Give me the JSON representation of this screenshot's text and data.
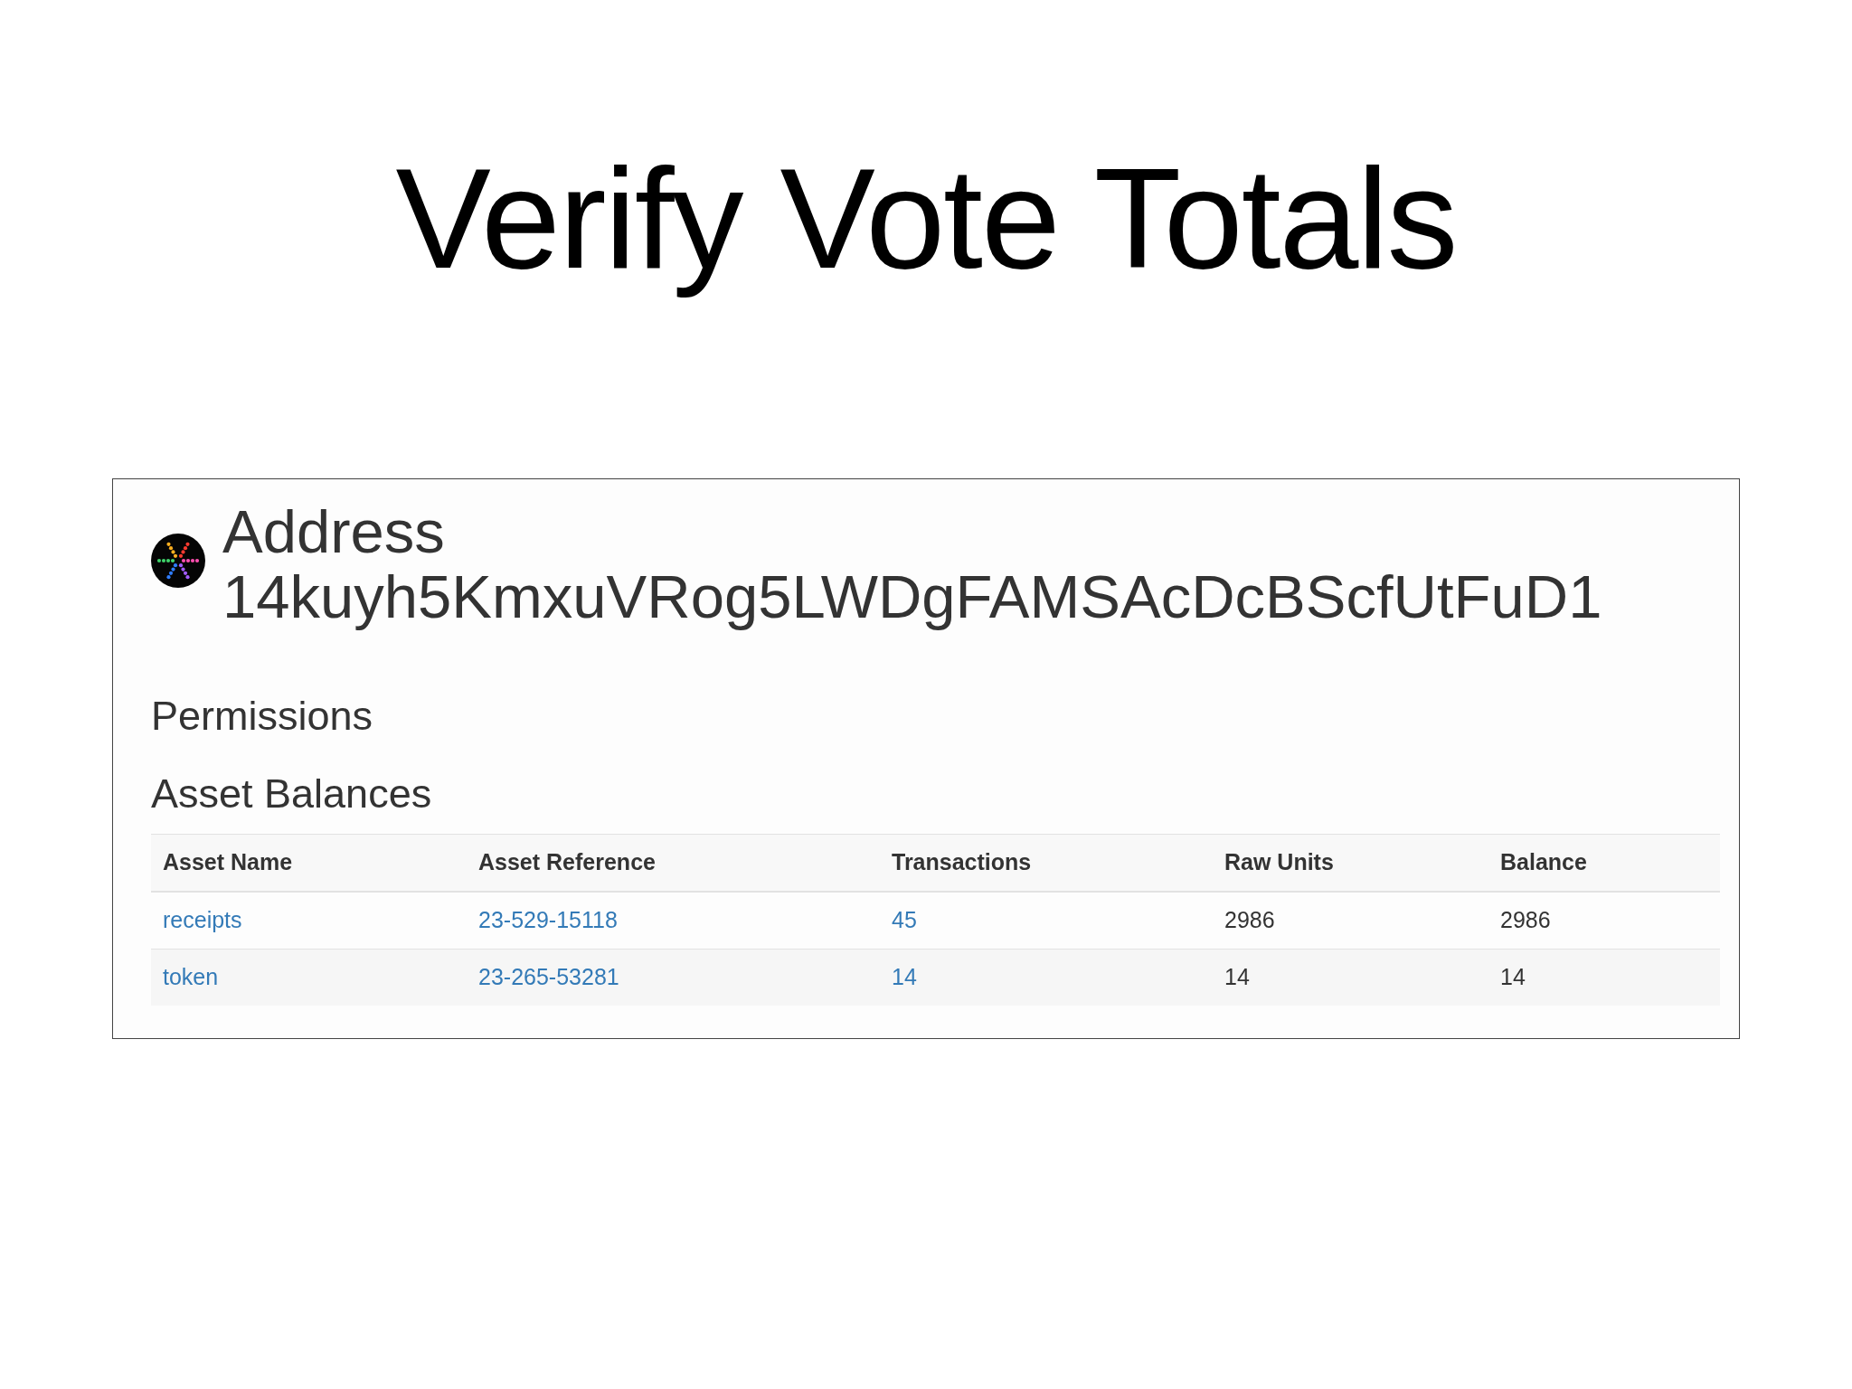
{
  "slide": {
    "title": "Verify Vote Totals"
  },
  "screenshot": {
    "address_label": "Address",
    "address": "14kuyh5KmxuVRog5LWDgFAMSAcDcBScfUtFuD1",
    "permissions_heading": "Permissions",
    "asset_balances": {
      "heading": "Asset Balances",
      "table": {
        "columns": [
          "Asset Name",
          "Asset Reference",
          "Transactions",
          "Raw Units",
          "Balance"
        ],
        "rows": [
          {
            "cells": [
              {
                "kind": "link",
                "text": "receipts"
              },
              {
                "kind": "link",
                "text": "23-529-15118"
              },
              {
                "kind": "link",
                "text": "45"
              },
              {
                "kind": "text",
                "text": "2986"
              },
              {
                "kind": "text",
                "text": "2986"
              }
            ]
          },
          {
            "cells": [
              {
                "kind": "link",
                "text": "token"
              },
              {
                "kind": "link",
                "text": "23-265-53281"
              },
              {
                "kind": "link",
                "text": "14"
              },
              {
                "kind": "text",
                "text": "14"
              },
              {
                "kind": "text",
                "text": "14"
              }
            ]
          }
        ]
      }
    }
  }
}
